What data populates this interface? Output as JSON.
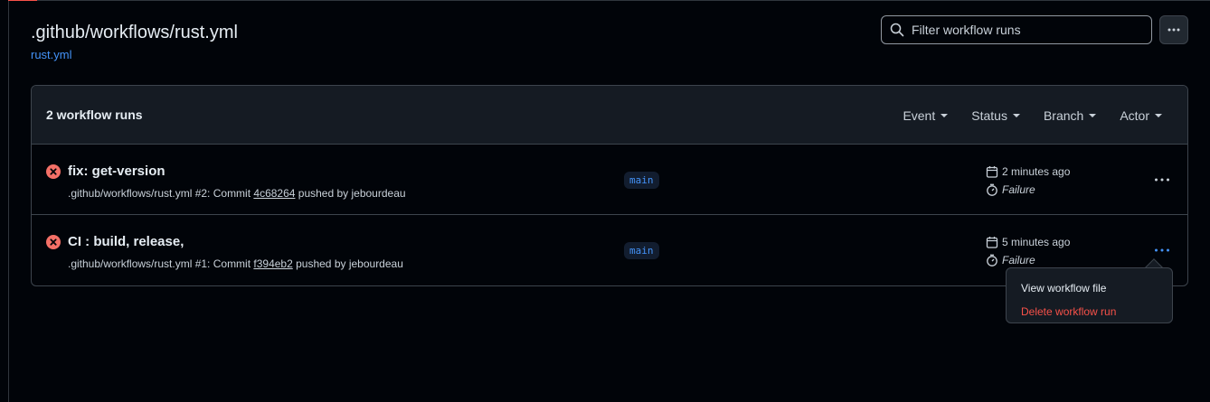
{
  "header": {
    "title": ".github/workflows/rust.yml",
    "subtitle": "rust.yml",
    "search_placeholder": "Filter workflow runs"
  },
  "list": {
    "count_label": "2 workflow runs",
    "filters": [
      "Event",
      "Status",
      "Branch",
      "Actor"
    ],
    "runs": [
      {
        "title": "fix: get-version",
        "meta_prefix": ".github/workflows/rust.yml #2: Commit ",
        "sha": "4c68264",
        "meta_suffix": " pushed by jebourdeau",
        "branch": "main",
        "time": "2 minutes ago",
        "status": "Failure"
      },
      {
        "title": "CI : build, release,",
        "meta_prefix": ".github/workflows/rust.yml #1: Commit ",
        "sha": "f394eb2",
        "meta_suffix": " pushed by jebourdeau",
        "branch": "main",
        "time": "5 minutes ago",
        "status": "Failure"
      }
    ]
  },
  "menu": {
    "view": "View workflow file",
    "delete": "Delete workflow run"
  },
  "colors": {
    "background": "#010409",
    "link": "#4493f8",
    "danger": "#f85149",
    "fail_icon": "#f47067"
  }
}
